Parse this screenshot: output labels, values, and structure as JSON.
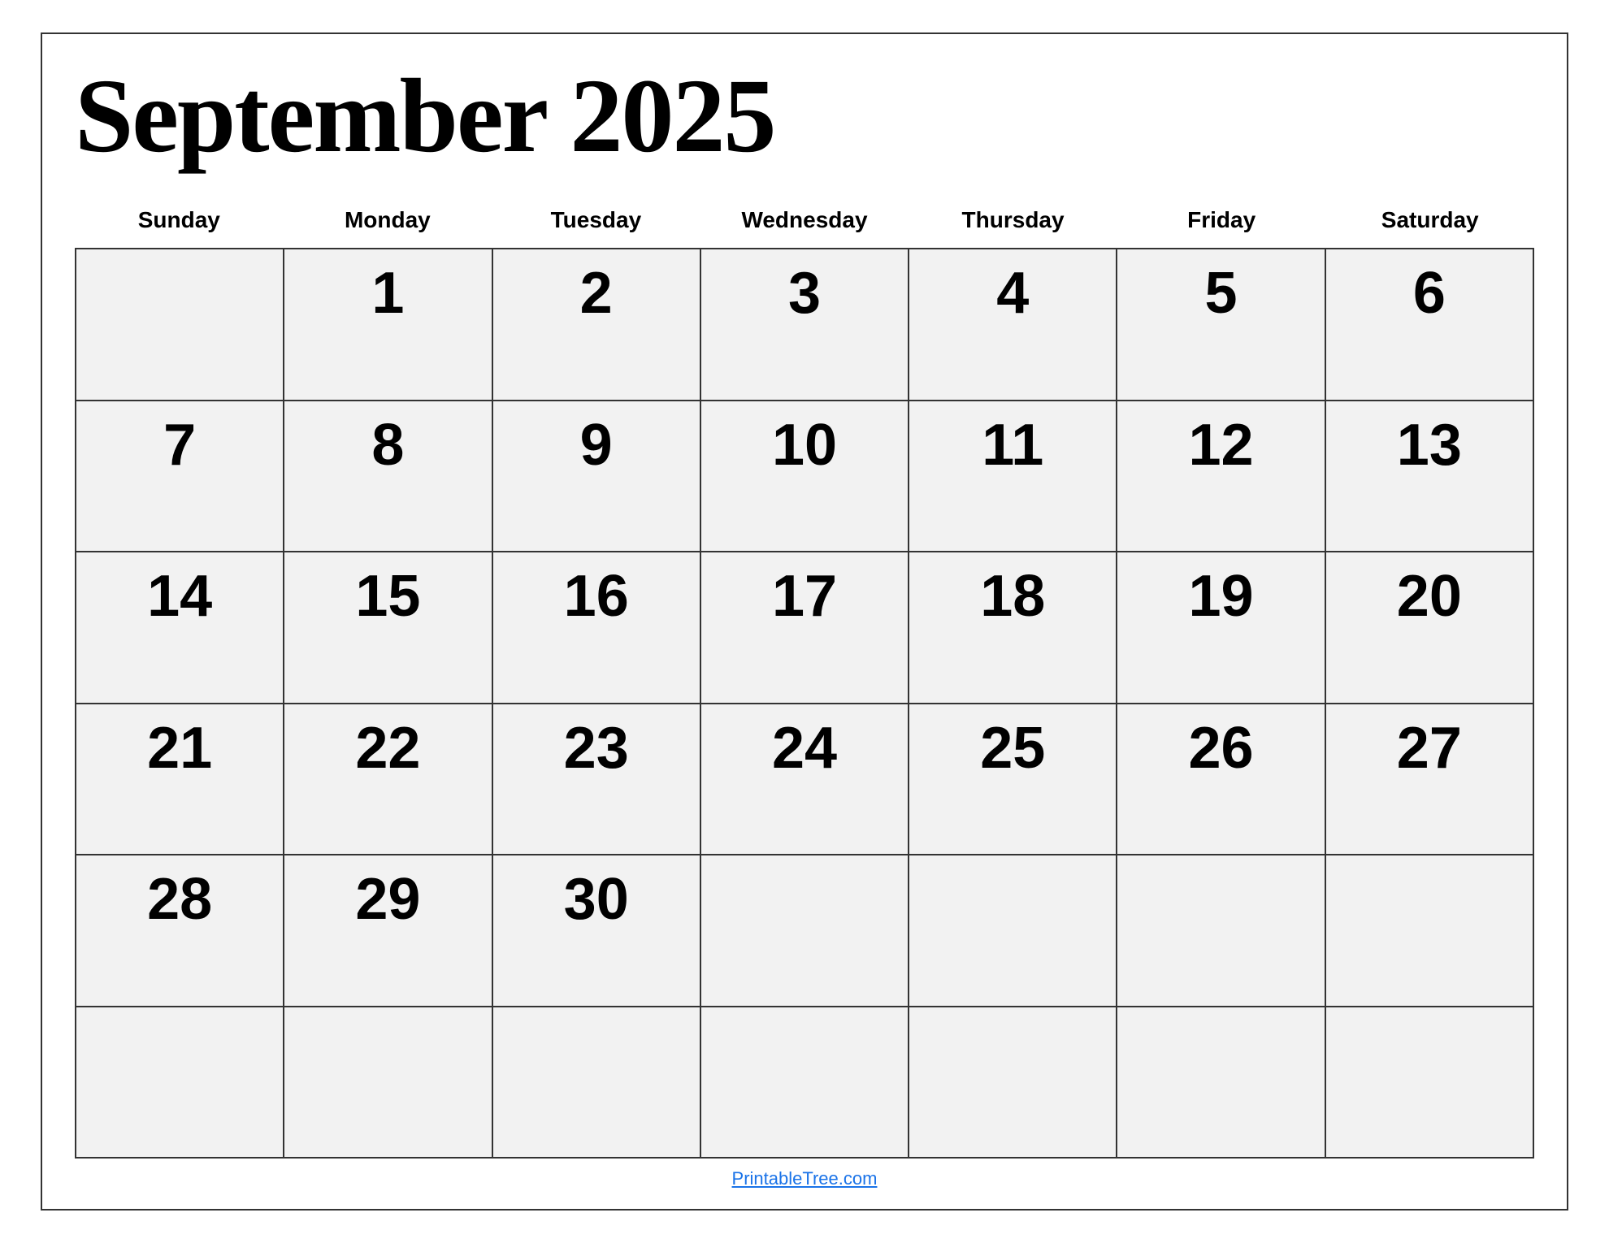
{
  "title": "September 2025",
  "days_of_week": [
    "Sunday",
    "Monday",
    "Tuesday",
    "Wednesday",
    "Thursday",
    "Friday",
    "Saturday"
  ],
  "weeks": [
    [
      {
        "day": "",
        "empty": true
      },
      {
        "day": "1",
        "empty": false
      },
      {
        "day": "2",
        "empty": false
      },
      {
        "day": "3",
        "empty": false
      },
      {
        "day": "4",
        "empty": false
      },
      {
        "day": "5",
        "empty": false
      },
      {
        "day": "6",
        "empty": false
      }
    ],
    [
      {
        "day": "7",
        "empty": false
      },
      {
        "day": "8",
        "empty": false
      },
      {
        "day": "9",
        "empty": false
      },
      {
        "day": "10",
        "empty": false
      },
      {
        "day": "11",
        "empty": false
      },
      {
        "day": "12",
        "empty": false
      },
      {
        "day": "13",
        "empty": false
      }
    ],
    [
      {
        "day": "14",
        "empty": false
      },
      {
        "day": "15",
        "empty": false
      },
      {
        "day": "16",
        "empty": false
      },
      {
        "day": "17",
        "empty": false
      },
      {
        "day": "18",
        "empty": false
      },
      {
        "day": "19",
        "empty": false
      },
      {
        "day": "20",
        "empty": false
      }
    ],
    [
      {
        "day": "21",
        "empty": false
      },
      {
        "day": "22",
        "empty": false
      },
      {
        "day": "23",
        "empty": false
      },
      {
        "day": "24",
        "empty": false
      },
      {
        "day": "25",
        "empty": false
      },
      {
        "day": "26",
        "empty": false
      },
      {
        "day": "27",
        "empty": false
      }
    ],
    [
      {
        "day": "28",
        "empty": false
      },
      {
        "day": "29",
        "empty": false
      },
      {
        "day": "30",
        "empty": false
      },
      {
        "day": "",
        "empty": true
      },
      {
        "day": "",
        "empty": true
      },
      {
        "day": "",
        "empty": true
      },
      {
        "day": "",
        "empty": true
      }
    ],
    [
      {
        "day": "",
        "empty": true
      },
      {
        "day": "",
        "empty": true
      },
      {
        "day": "",
        "empty": true
      },
      {
        "day": "",
        "empty": true
      },
      {
        "day": "",
        "empty": true
      },
      {
        "day": "",
        "empty": true
      },
      {
        "day": "",
        "empty": true
      }
    ]
  ],
  "footer_link_text": "PrintableTree.com",
  "footer_link_url": "https://PrintableTree.com"
}
